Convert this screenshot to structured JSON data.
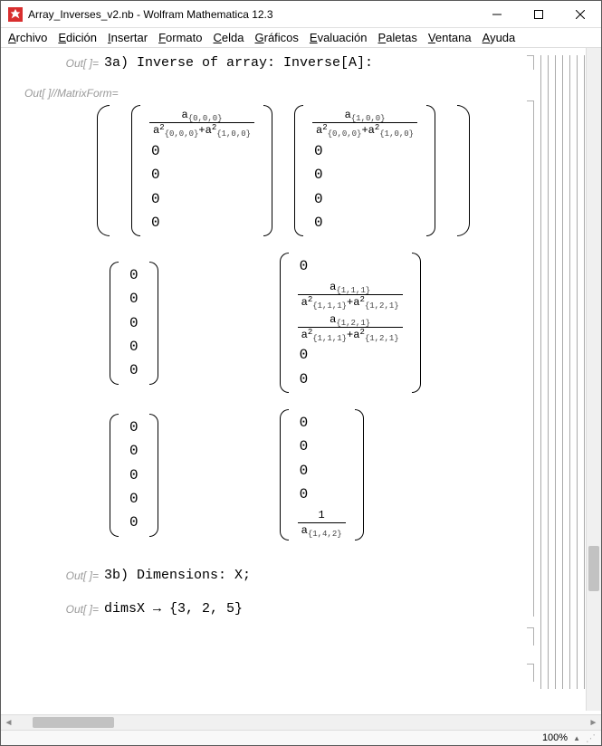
{
  "window": {
    "title": "Array_Inverses_v2.nb - Wolfram Mathematica 12.3"
  },
  "menu": [
    "Archivo",
    "Edición",
    "Insertar",
    "Formato",
    "Celda",
    "Gráficos",
    "Evaluación",
    "Paletas",
    "Ventana",
    "Ayuda"
  ],
  "out_label": "Out[ ]=",
  "matrixform_label": "Out[ ]//MatrixForm=",
  "lines": {
    "l1": "3a) Inverse of array: Inverse[A]:",
    "l3b": "3b) Dimensions: X;",
    "dims": "dimsX → {3, 2, 5}"
  },
  "fracs": {
    "r1c1": {
      "num_a": "a",
      "num_sub": "{0,0,0}",
      "da": "a",
      "da_sub": "{0,0,0}",
      "plus": "+",
      "db": "a",
      "db_sub": "{1,0,0}"
    },
    "r1c2": {
      "num_a": "a",
      "num_sub": "{1,0,0}",
      "da": "a",
      "da_sub": "{0,0,0}",
      "plus": "+",
      "db": "a",
      "db_sub": "{1,0,0}"
    },
    "r2f1": {
      "num_a": "a",
      "num_sub": "{1,1,1}",
      "da": "a",
      "da_sub": "{1,1,1}",
      "plus": "+",
      "db": "a",
      "db_sub": "{1,2,1}"
    },
    "r2f2": {
      "num_a": "a",
      "num_sub": "{1,2,1}",
      "da": "a",
      "da_sub": "{1,1,1}",
      "plus": "+",
      "db": "a",
      "db_sub": "{1,2,1}"
    },
    "r3": {
      "num": "1",
      "da": "a",
      "da_sub": "{1,4,2}"
    }
  },
  "zero": "0",
  "status": {
    "zoom": "100%"
  }
}
